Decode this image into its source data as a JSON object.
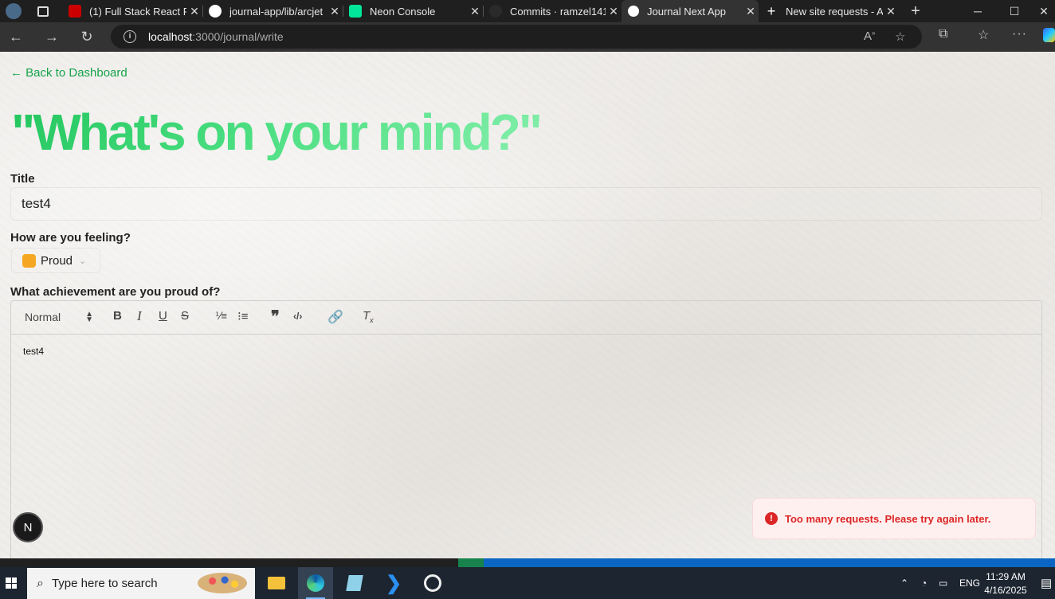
{
  "browser": {
    "tabs": [
      {
        "title": "(1) Full Stack React Pr",
        "icon": "youtube-icon",
        "color": "#ff0000"
      },
      {
        "title": "journal-app/lib/arcjet",
        "icon": "github-icon",
        "color": "#ffffff"
      },
      {
        "title": "Neon Console",
        "icon": "neon-icon",
        "color": "#00e599"
      },
      {
        "title": "Commits · ramzel141",
        "icon": "github-icon",
        "color": "#333333"
      },
      {
        "title": "Journal Next App",
        "icon": "vercel-icon",
        "color": "#ffffff"
      },
      {
        "title": "New site requests - A",
        "icon": "plus-icon",
        "color": "#ffffff"
      }
    ],
    "address": {
      "host": "localhost",
      "path": ":3000/journal/write"
    }
  },
  "page": {
    "back_link": "← Back to Dashboard",
    "headline": "\"What's on your mind?\"",
    "title_label": "Title",
    "title_value": "test4",
    "mood_label": "How are you feeling?",
    "mood_value": "Proud",
    "mood_emoji": "🦁",
    "prompt_label": "What achievement are you proud of?",
    "editor": {
      "format_select": "Normal",
      "content": "test4"
    },
    "toast": {
      "message": "Too many requests. Please try again later.",
      "color": "#dc2626"
    },
    "dev_badge": "N"
  },
  "taskbar": {
    "search_placeholder": "Type here to search",
    "language": "ENG",
    "time": "11:29 AM",
    "date": "4/16/2025"
  }
}
